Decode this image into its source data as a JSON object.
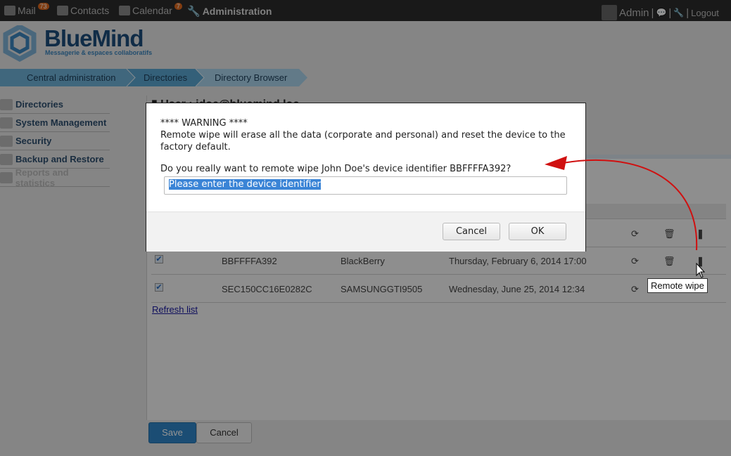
{
  "topbar": {
    "apps": [
      {
        "label": "Mail",
        "badge": "73",
        "icon": "mail-icon"
      },
      {
        "label": "Contacts",
        "icon": "contacts-icon"
      },
      {
        "label": "Calendar",
        "badge": "7",
        "icon": "calendar-icon"
      },
      {
        "label": "Administration",
        "icon": "wrench-icon"
      }
    ],
    "user": "Admin",
    "logout": "Logout"
  },
  "logo": {
    "name": "BlueMind",
    "tagline": "Messagerie & espaces collaboratifs"
  },
  "breadcrumb": [
    "Central administration",
    "Directories",
    "Directory Browser"
  ],
  "sidebar": {
    "items": [
      {
        "label": "Directories"
      },
      {
        "label": "System Management"
      },
      {
        "label": "Security"
      },
      {
        "label": "Backup and Restore"
      },
      {
        "label": "Reports and statistics",
        "disabled": true
      }
    ]
  },
  "main": {
    "title": "User : jdoe@bluemind.loc",
    "devices": [
      {
        "id": "BBFFFFA392",
        "model": "BlackBerry",
        "last_sync": "Thursday, February 6, 2014 17:00"
      },
      {
        "id": "SEC150CC16E0282C",
        "model": "SAMSUNGGTI9505",
        "last_sync": "Wednesday, June 25, 2014 12:34"
      }
    ],
    "refresh": "Refresh list",
    "tooltip": "Remote wipe",
    "save": "Save",
    "cancel": "Cancel"
  },
  "dialog": {
    "warning": "**** WARNING ****",
    "message": "Remote wipe will erase all the data (corporate and personal) and reset the device to the factory default.",
    "question": "Do you really want to remote wipe John Doe's device identifier BBFFFFA392?",
    "input_value": "Please enter the device identifier",
    "cancel": "Cancel",
    "ok": "OK"
  },
  "colors": {
    "accent": "#2f86c8",
    "annotation_arrow": "#d01010"
  }
}
